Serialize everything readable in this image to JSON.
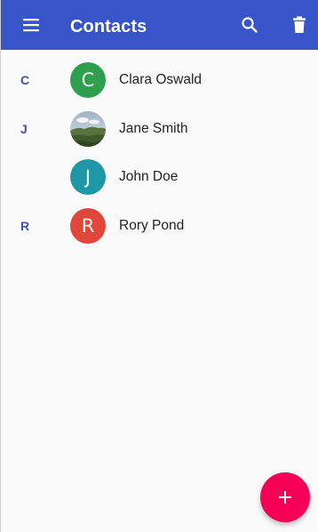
{
  "appbar": {
    "title": "Contacts",
    "menu_icon": "menu-icon",
    "search_icon": "search-icon",
    "delete_icon": "trash-icon"
  },
  "contacts": [
    {
      "section": "C",
      "initial": "C",
      "name": "Clara Oswald",
      "avatar": "letter",
      "avatar_color": "#2e9e4f"
    },
    {
      "section": "J",
      "initial": "",
      "name": "Jane Smith",
      "avatar": "photo",
      "avatar_color": "#6d8a55"
    },
    {
      "section": "",
      "initial": "J",
      "name": "John Doe",
      "avatar": "letter",
      "avatar_color": "#1e97a6"
    },
    {
      "section": "R",
      "initial": "R",
      "name": "Rory Pond",
      "avatar": "letter",
      "avatar_color": "#e0473a"
    }
  ],
  "fab": {
    "icon": "plus-icon",
    "label": "+"
  },
  "colors": {
    "primary": "#3f51b5",
    "appbar": "#3754c8",
    "accent": "#f50057",
    "background": "#fafafa"
  }
}
